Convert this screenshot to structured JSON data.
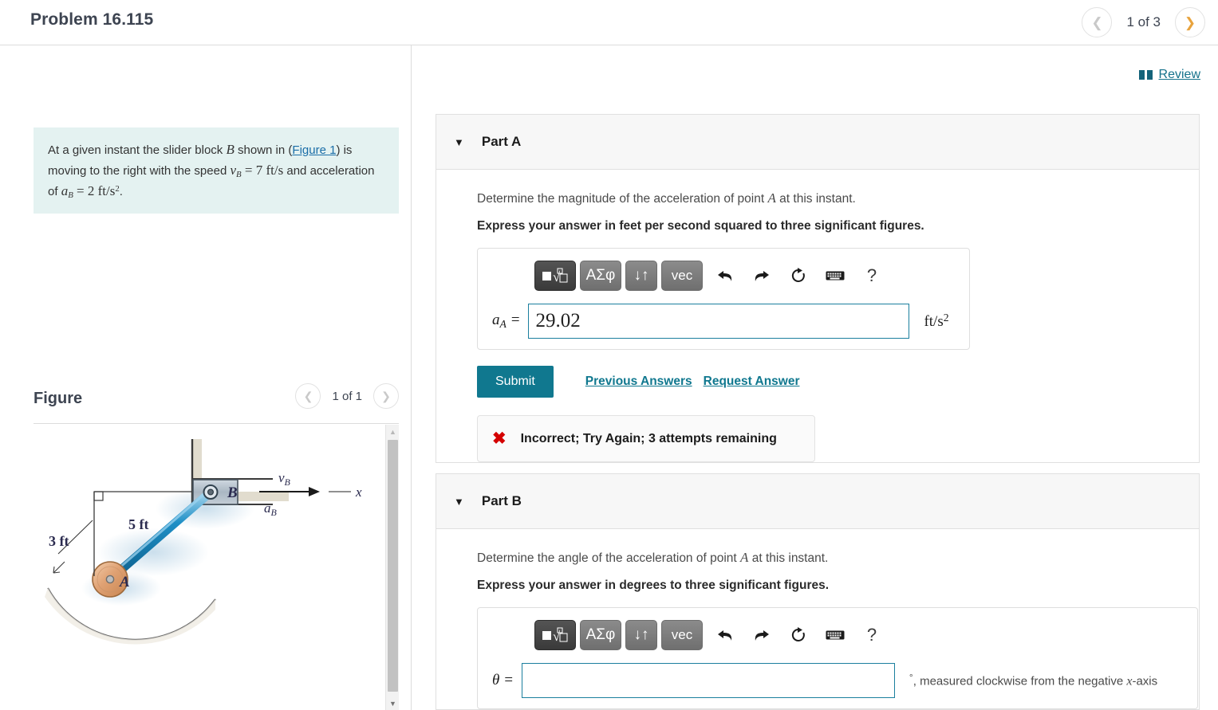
{
  "header": {
    "problem_title": "Problem 16.115",
    "pager": {
      "prev_icon": "chevron-left-icon",
      "label": "1 of 3",
      "next_icon": "chevron-right-icon"
    }
  },
  "review": {
    "icon": "book-icon",
    "label": "Review"
  },
  "left": {
    "statement": {
      "line1_a": "At a given instant the slider block ",
      "var_B": "B",
      "line1_b": " shown in (",
      "figure_link": "Figure 1",
      "line1_c": ") is",
      "line2_a": "moving to the right with the speed ",
      "vB": "v",
      "vB_sub": "B",
      "eq1": " = 7 ",
      "unit1": "ft/s",
      "line2_b": " and",
      "line3_a": "acceleration of ",
      "aB": "a",
      "aB_sub": "B",
      "eq2": " = 2 ",
      "unit2": "ft/s",
      "unit2_sup": "2",
      "period": "."
    },
    "figure": {
      "title": "Figure",
      "pager": {
        "prev_icon": "chevron-left-icon",
        "label": "1 of 1",
        "next_icon": "chevron-right-icon"
      },
      "labels": {
        "point_A": "A",
        "point_B": "B",
        "len_rod": "5 ft",
        "len_radius": "3 ft",
        "vB": "v",
        "vB_sub": "B",
        "aB": "a",
        "aB_sub": "B",
        "axis_x": "x"
      },
      "scrollbar": {
        "up_icon": "scroll-up-arrow-icon",
        "down_icon": "scroll-down-arrow-icon"
      }
    }
  },
  "math_toolbar": {
    "buttons": [
      {
        "name": "template-sqrt-button",
        "label": "■√□"
      },
      {
        "name": "greek-symbols-button",
        "label": "ΑΣφ"
      },
      {
        "name": "updown-arrows-button",
        "label": "↓↑"
      },
      {
        "name": "vector-button",
        "label": "vec"
      }
    ],
    "icons": [
      {
        "name": "undo-icon",
        "glyph": "⬅"
      },
      {
        "name": "redo-icon",
        "glyph": "➡"
      },
      {
        "name": "reset-icon",
        "glyph": "↻"
      },
      {
        "name": "keyboard-icon",
        "glyph": "⌨"
      },
      {
        "name": "help-icon",
        "glyph": "?"
      }
    ]
  },
  "parts": [
    {
      "id": "A",
      "caret": "▼",
      "label": "Part A",
      "question": "Determine the magnitude of the acceleration of point A at this instant.",
      "question_pre": "Determine the magnitude of the acceleration of point ",
      "question_var": "A",
      "question_post": " at this instant.",
      "instruction": "Express your answer in feet per second squared to three significant figures.",
      "field": {
        "label_var": "a",
        "label_sub": "A",
        "label_eq": " =",
        "value": "29.02",
        "placeholder": "",
        "unit": "ft/s",
        "unit_sup": "2"
      },
      "submit_label": "Submit",
      "previous_answers_label": "Previous Answers",
      "request_answer_label": "Request Answer",
      "feedback": {
        "icon": "x-mark-icon",
        "text": "Incorrect; Try Again; 3 attempts remaining"
      }
    },
    {
      "id": "B",
      "caret": "▼",
      "label": "Part B",
      "question_pre": "Determine the angle of the acceleration of point ",
      "question_var": "A",
      "question_post": " at this instant.",
      "instruction": "Express your answer in degrees to three significant figures.",
      "field": {
        "label_var": "θ",
        "label_eq": " =",
        "value": "",
        "placeholder": "",
        "unit_deg": "°",
        "unit_tail_a": ", measured clockwise from the negative ",
        "unit_tail_var": "x",
        "unit_tail_b": "-axis"
      }
    }
  ],
  "colors": {
    "accent_teal": "#10788f",
    "statement_bg": "#e4f2f1",
    "error_red": "#d40000",
    "next_arrow": "#e8a33d",
    "panel_border": "#e0e0e0"
  }
}
